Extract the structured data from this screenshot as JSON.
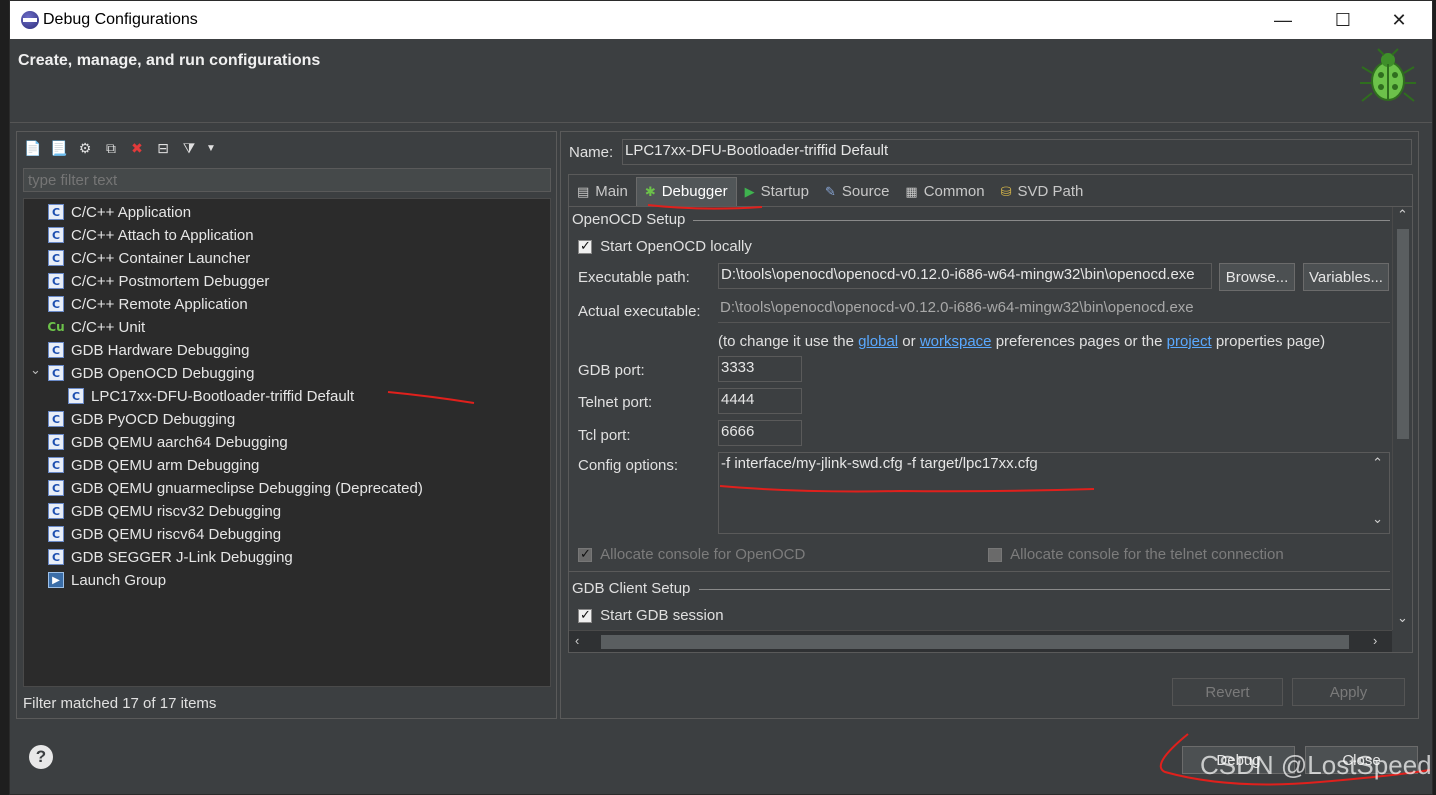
{
  "window": {
    "title": "Debug Configurations",
    "minimize": "—",
    "maximize": "☐",
    "close": "✕"
  },
  "header": {
    "heading": "Create, manage, and run configurations"
  },
  "left": {
    "filter_placeholder": "type filter text",
    "items": [
      {
        "label": "C/C++ Application",
        "icon": "c-icon"
      },
      {
        "label": "C/C++ Attach to Application",
        "icon": "c-icon"
      },
      {
        "label": "C/C++ Container Launcher",
        "icon": "c-icon"
      },
      {
        "label": "C/C++ Postmortem Debugger",
        "icon": "c-icon"
      },
      {
        "label": "C/C++ Remote Application",
        "icon": "c-icon"
      },
      {
        "label": "C/C++ Unit",
        "icon": "cunit-icon"
      },
      {
        "label": "GDB Hardware Debugging",
        "icon": "c-icon"
      },
      {
        "label": "GDB OpenOCD Debugging",
        "icon": "c-icon"
      },
      {
        "label": "LPC17xx-DFU-Bootloader-triffid Default",
        "icon": "c-icon"
      },
      {
        "label": "GDB PyOCD Debugging",
        "icon": "c-icon"
      },
      {
        "label": "GDB QEMU aarch64 Debugging",
        "icon": "c-icon"
      },
      {
        "label": "GDB QEMU arm Debugging",
        "icon": "c-icon"
      },
      {
        "label": "GDB QEMU gnuarmeclipse Debugging (Deprecated)",
        "icon": "c-icon"
      },
      {
        "label": "GDB QEMU riscv32 Debugging",
        "icon": "c-icon"
      },
      {
        "label": "GDB QEMU riscv64 Debugging",
        "icon": "c-icon"
      },
      {
        "label": "GDB SEGGER J-Link Debugging",
        "icon": "c-icon"
      },
      {
        "label": "Launch Group",
        "icon": "launch-group-icon"
      }
    ],
    "status": "Filter matched 17 of 17 items"
  },
  "right": {
    "name_label": "Name:",
    "name_value": "LPC17xx-DFU-Bootloader-triffid Default",
    "tabs": [
      {
        "label": "Main",
        "icon": "main-tab-icon"
      },
      {
        "label": "Debugger",
        "icon": "debugger-tab-icon",
        "active": true
      },
      {
        "label": "Startup",
        "icon": "startup-tab-icon"
      },
      {
        "label": "Source",
        "icon": "source-tab-icon"
      },
      {
        "label": "Common",
        "icon": "common-tab-icon"
      },
      {
        "label": "SVD Path",
        "icon": "svd-path-tab-icon"
      }
    ],
    "openocd": {
      "section_title": "OpenOCD Setup",
      "start_locally": "Start OpenOCD locally",
      "exec_label": "Executable path:",
      "exec_value": "D:\\tools\\openocd\\openocd-v0.12.0-i686-w64-mingw32\\bin\\openocd.exe",
      "browse": "Browse...",
      "variables": "Variables...",
      "actual_label": "Actual executable:",
      "actual_value": "D:\\tools\\openocd\\openocd-v0.12.0-i686-w64-mingw32\\bin\\openocd.exe",
      "hint_prefix": "(to change it use the ",
      "hint_global": "global",
      "hint_or": " or ",
      "hint_workspace": "workspace",
      "hint_mid": " preferences pages or the ",
      "hint_project": "project",
      "hint_suffix": " properties page)",
      "gdb_port_label": "GDB port:",
      "gdb_port": "3333",
      "telnet_port_label": "Telnet port:",
      "telnet_port": "4444",
      "tcl_port_label": "Tcl port:",
      "tcl_port": "6666",
      "config_label": "Config options:",
      "config_value": "-f interface/my-jlink-swd.cfg  -f target/lpc17xx.cfg",
      "alloc_console": "Allocate console for OpenOCD",
      "alloc_telnet": "Allocate console for the telnet connection"
    },
    "gdb": {
      "section_title": "GDB Client Setup",
      "start_session": "Start GDB session"
    },
    "revert": "Revert",
    "apply": "Apply"
  },
  "footer": {
    "help": "?",
    "debug": "Debug",
    "close": "Close"
  },
  "watermark": "CSDN @LostSpeed",
  "colors": {
    "annotation": "#e0201c",
    "link": "#5aa9ff",
    "background": "#3c3f41"
  }
}
